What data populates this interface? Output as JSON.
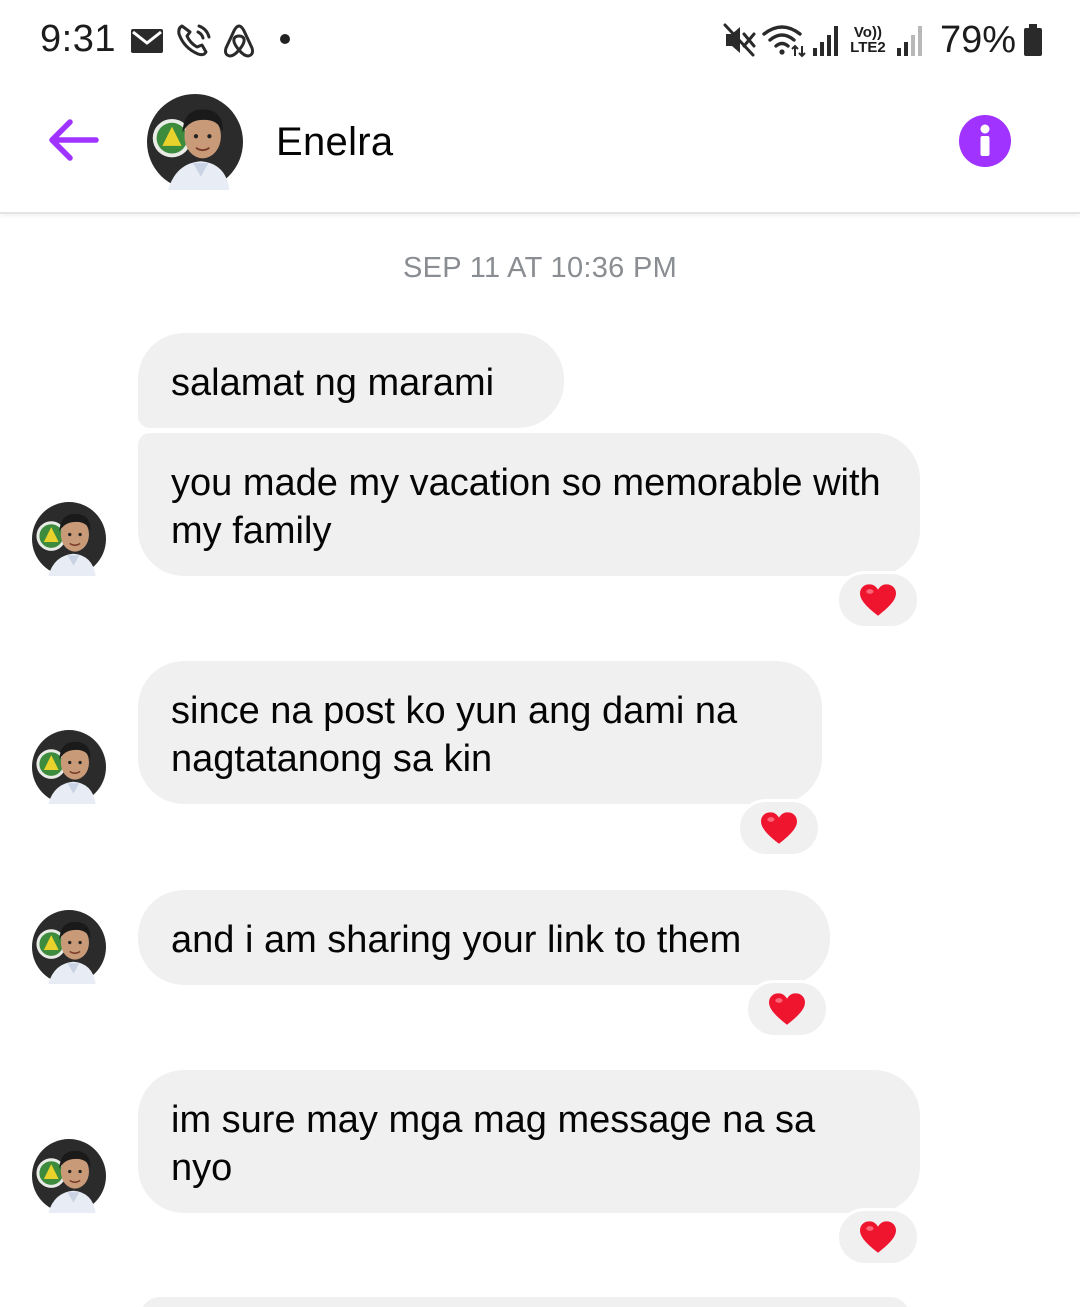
{
  "status_bar": {
    "time": "9:31",
    "battery": "79%",
    "network_label_top": "Vo))",
    "network_label_bottom": "LTE2",
    "icons": [
      "email-icon",
      "wifi-call-icon",
      "airbnb-icon",
      "dot-icon",
      "mute-icon",
      "wifi-icon",
      "signal-icon",
      "signal-icon-2",
      "battery-icon"
    ]
  },
  "header": {
    "contact_name": "Enelra",
    "back_icon": "arrow-left-icon",
    "info_icon": "info-icon",
    "accent_color": "#a033ff"
  },
  "conversation": {
    "timestamp": "SEP 11 AT 10:36 PM",
    "messages": [
      {
        "text": "salamat ng marami"
      },
      {
        "text": "you made my vacation so memorable with my family",
        "reaction": "heart"
      },
      {
        "text": "since na post ko yun ang dami na nagtatanong sa kin",
        "reaction": "heart"
      },
      {
        "text": "and i am sharing your link to them",
        "reaction": "heart"
      },
      {
        "text": "im sure may mga mag message na sa nyo",
        "reaction": "heart"
      }
    ]
  },
  "colors": {
    "bubble_bg": "#f0f0f0",
    "heart": "#f0152f"
  }
}
